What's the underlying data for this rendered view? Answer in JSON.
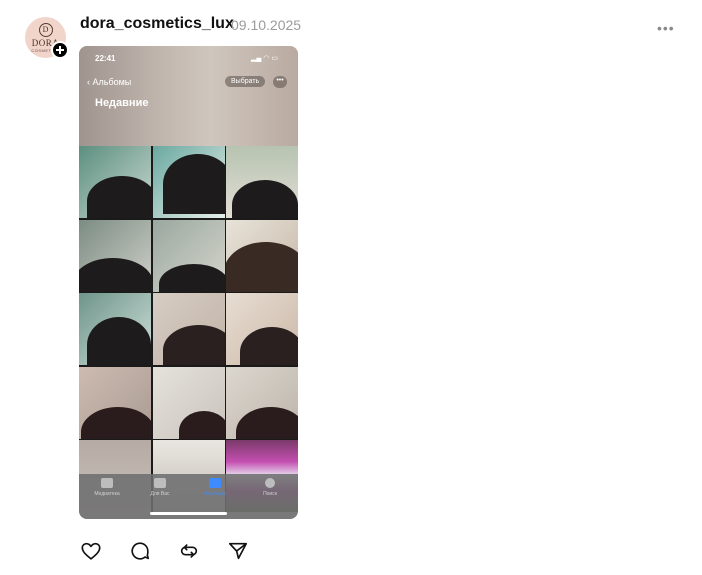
{
  "post": {
    "username": "dora_cosmetics_lux",
    "date": "09.10.2025",
    "avatar": {
      "brand": "DORA",
      "monogram": "D",
      "subline": "COSMETICS"
    },
    "icons": {
      "follow": "plus-icon",
      "more": "more-horizontal-icon"
    }
  },
  "screenshot": {
    "status_time": "22:41",
    "back_label": "Альбомы",
    "album_title": "Недавние",
    "select_button": "Выбрать",
    "options_button": "•••",
    "tabs": [
      {
        "label": "Медиатека",
        "icon": "photos-icon",
        "active": false
      },
      {
        "label": "Для Вас",
        "icon": "for-you-icon",
        "active": false
      },
      {
        "label": "Альбомы",
        "icon": "albums-icon",
        "active": true
      },
      {
        "label": "Поиск",
        "icon": "search-icon",
        "active": false
      }
    ]
  },
  "actions": [
    {
      "name": "like",
      "icon": "heart-icon"
    },
    {
      "name": "comment",
      "icon": "comment-icon"
    },
    {
      "name": "repost",
      "icon": "repost-icon"
    },
    {
      "name": "share",
      "icon": "send-icon"
    }
  ],
  "colors": {
    "accent": "#3d8bff",
    "text": "#111111",
    "muted": "#9b9b9b"
  }
}
